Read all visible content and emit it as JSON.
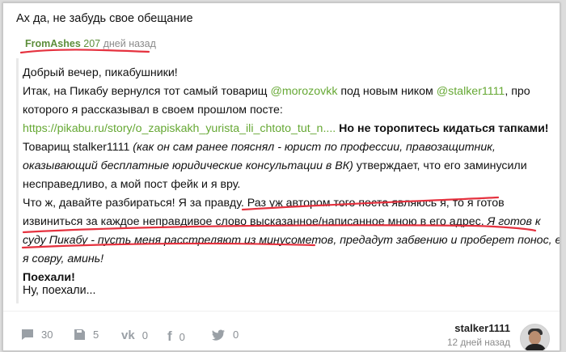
{
  "top_text": "Ах да, не забудь свое обещание",
  "quote": {
    "author": "FromAshes",
    "count": "207",
    "ago": "дней назад",
    "lines": {
      "l1": "Добрый вечер, пикабушники!",
      "l2a": "Итак, на Пикабу вернулся тот самый товарищ ",
      "l2b": "@morozovkk",
      "l2c": " под новым ником ",
      "l2d": "@stalker1111",
      "l2e": ", про",
      "l3": "которого я рассказывал в своем прошлом посте:",
      "l4a": "https://pikabu.ru/story/o_zapiskakh_yurista_ili_chtoto_tut_n....",
      "l4b": " Но не торопитесь кидаться тапками!",
      "l5a": "Товарищ stalker1111 ",
      "l5b": "(как он сам ранее пояснял - юрист по профессии, правозащитник,",
      "l6a": "оказывающий бесплатные юридические консультации в ВК)",
      "l6b": " утверждает, что его заминусили",
      "l7": "несправедливо, а мой пост фейк и я вру.",
      "l8": "Что ж, давайте разбираться! Я за правду. Раз уж автором того поста являюсь я, то я готов",
      "l9a": "извиниться за каждое неправдивое слово высказанное/написанное мною в его адрес. ",
      "l9b": "Я готов к",
      "l10a": "суду Пикабу - пусть меня расстреляют из минусометов",
      "l10b": ", предадут забвению и проберет понос, если",
      "l11": "я совру, аминь!",
      "l12": "Поехали!"
    }
  },
  "after_text": "Ну, поехали...",
  "footer": {
    "comments": "30",
    "saves": "5",
    "vk": "0",
    "fb": "0",
    "tw": "0",
    "username": "stalker1111",
    "time": "12 дней назад"
  },
  "colors": {
    "accent_green": "#66a834",
    "underline_red": "#e5323f",
    "muted_gray": "#8a8f94"
  }
}
